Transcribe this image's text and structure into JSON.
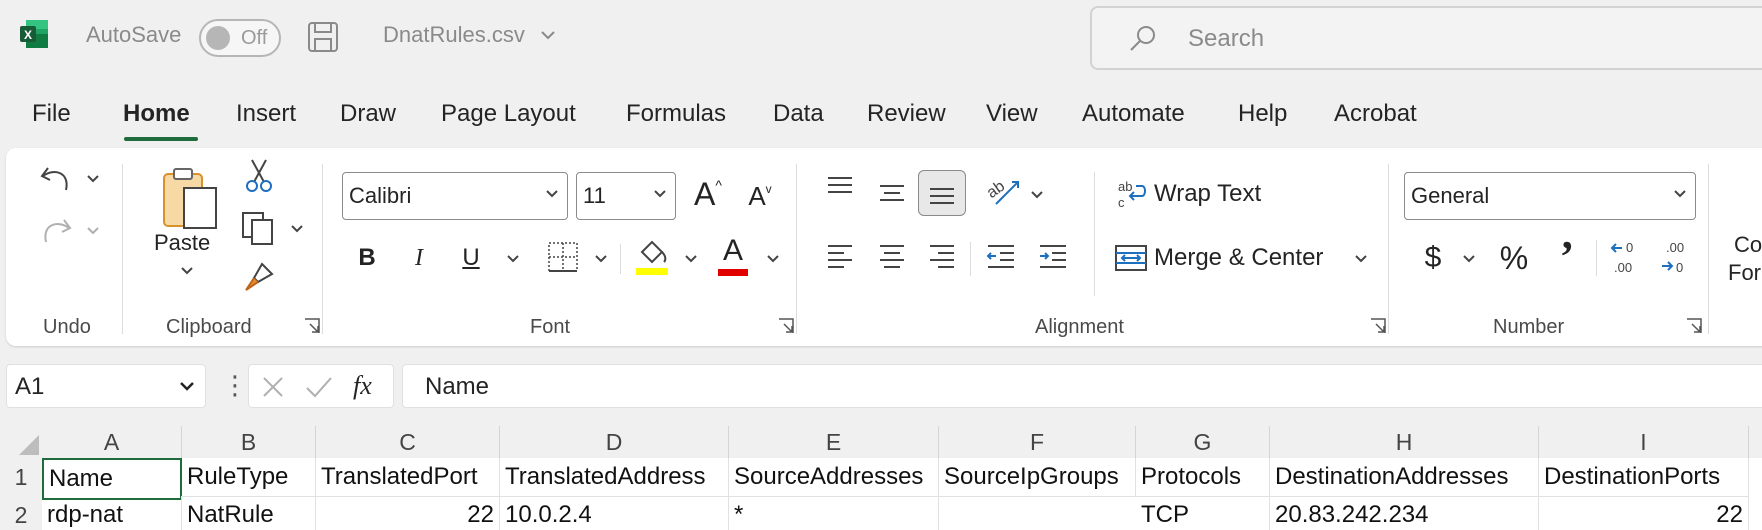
{
  "titlebar": {
    "autosave_label": "AutoSave",
    "autosave_state": "Off",
    "filename": "DnatRules.csv",
    "search_placeholder": "Search"
  },
  "tabs": [
    "File",
    "Home",
    "Insert",
    "Draw",
    "Page Layout",
    "Formulas",
    "Data",
    "Review",
    "View",
    "Automate",
    "Help",
    "Acrobat"
  ],
  "active_tab": "Home",
  "ribbon": {
    "groups": {
      "undo": "Undo",
      "clipboard": "Clipboard",
      "font": "Font",
      "alignment": "Alignment",
      "number": "Number"
    },
    "paste_label": "Paste",
    "font_name": "Calibri",
    "font_size": "11",
    "bold": "B",
    "italic": "I",
    "underline": "U",
    "font_color_glyph": "A",
    "grow_font": "A",
    "shrink_font": "A",
    "wrap_text": "Wrap Text",
    "merge_center": "Merge & Center",
    "number_format": "General",
    "currency": "$",
    "percent": "%",
    "comma": "’",
    "cut_off_label_1": "Co",
    "cut_off_label_2": "For"
  },
  "formula_bar": {
    "name_box": "A1",
    "fx": "fx",
    "content": "Name"
  },
  "sheet": {
    "columns": [
      "A",
      "B",
      "C",
      "D",
      "E",
      "F",
      "G",
      "H",
      "I"
    ],
    "row_numbers": [
      "1",
      "2"
    ],
    "rows": [
      [
        "Name",
        "RuleType",
        "TranslatedPort",
        "TranslatedAddress",
        "SourceAddresses",
        "SourceIpGroups",
        "Protocols",
        "DestinationAddresses",
        "DestinationPorts"
      ],
      [
        "rdp-nat",
        "NatRule",
        "22",
        "10.0.2.4",
        "*",
        "",
        "TCP",
        "20.83.242.234",
        "22"
      ]
    ]
  },
  "colors": {
    "excel_green": "#1e6b3b",
    "highlight_yellow": "#ffff00",
    "font_red": "#e00000"
  }
}
